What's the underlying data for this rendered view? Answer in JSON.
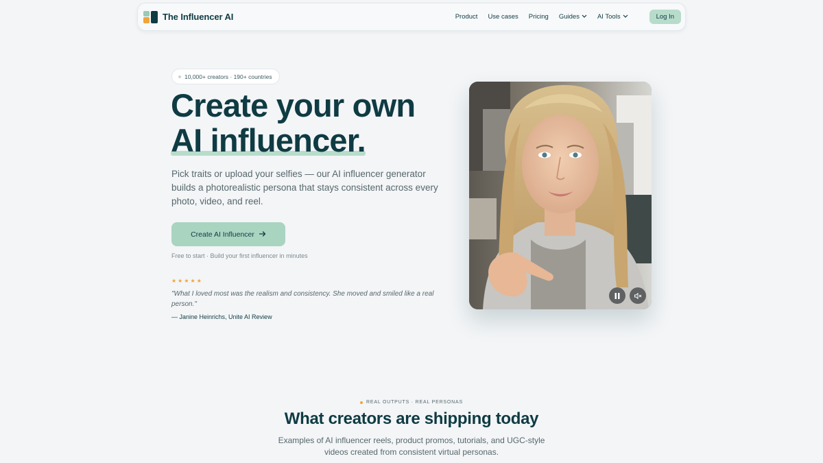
{
  "nav": {
    "brand": "The Influencer AI",
    "links": [
      {
        "label": "Product",
        "dropdown": false
      },
      {
        "label": "Use cases",
        "dropdown": false
      },
      {
        "label": "Pricing",
        "dropdown": false
      },
      {
        "label": "Guides",
        "dropdown": true
      },
      {
        "label": "AI Tools",
        "dropdown": true
      }
    ],
    "login_label": "Log In"
  },
  "hero": {
    "badge": "10,000+ creators · 190+ countries",
    "headline_line1": "Create your own",
    "headline_line2": "AI influencer.",
    "subtext": "Pick traits or upload your selfies — our AI influencer generator builds a photorealistic persona that stays consistent across every photo, video, and reel.",
    "cta_label": "Create AI Influencer",
    "cta_note": "Free to start · Build your first influencer in minutes",
    "rating_stars": 5,
    "quote": "\"What I loved most was the realism and consistency. She moved and smiled like a real person.\"",
    "quote_author": "— Janine Heinrichs, Unite AI Review"
  },
  "section": {
    "eyebrow": "REAL OUTPUTS · REAL PERSONAS",
    "title": "What creators are shipping today",
    "subtitle": "Examples of AI influencer reels, product promos, tutorials, and UGC-style videos created from consistent virtual personas."
  },
  "icons": {
    "pause": "pause-icon",
    "mute": "volume-mute-icon",
    "arrow": "arrow-right-icon",
    "star": "star-icon"
  },
  "colors": {
    "primary": "#0f3b43",
    "accent_mint": "#b7dccb",
    "accent_orange": "#f0a43a",
    "background": "#f3f5f7"
  }
}
